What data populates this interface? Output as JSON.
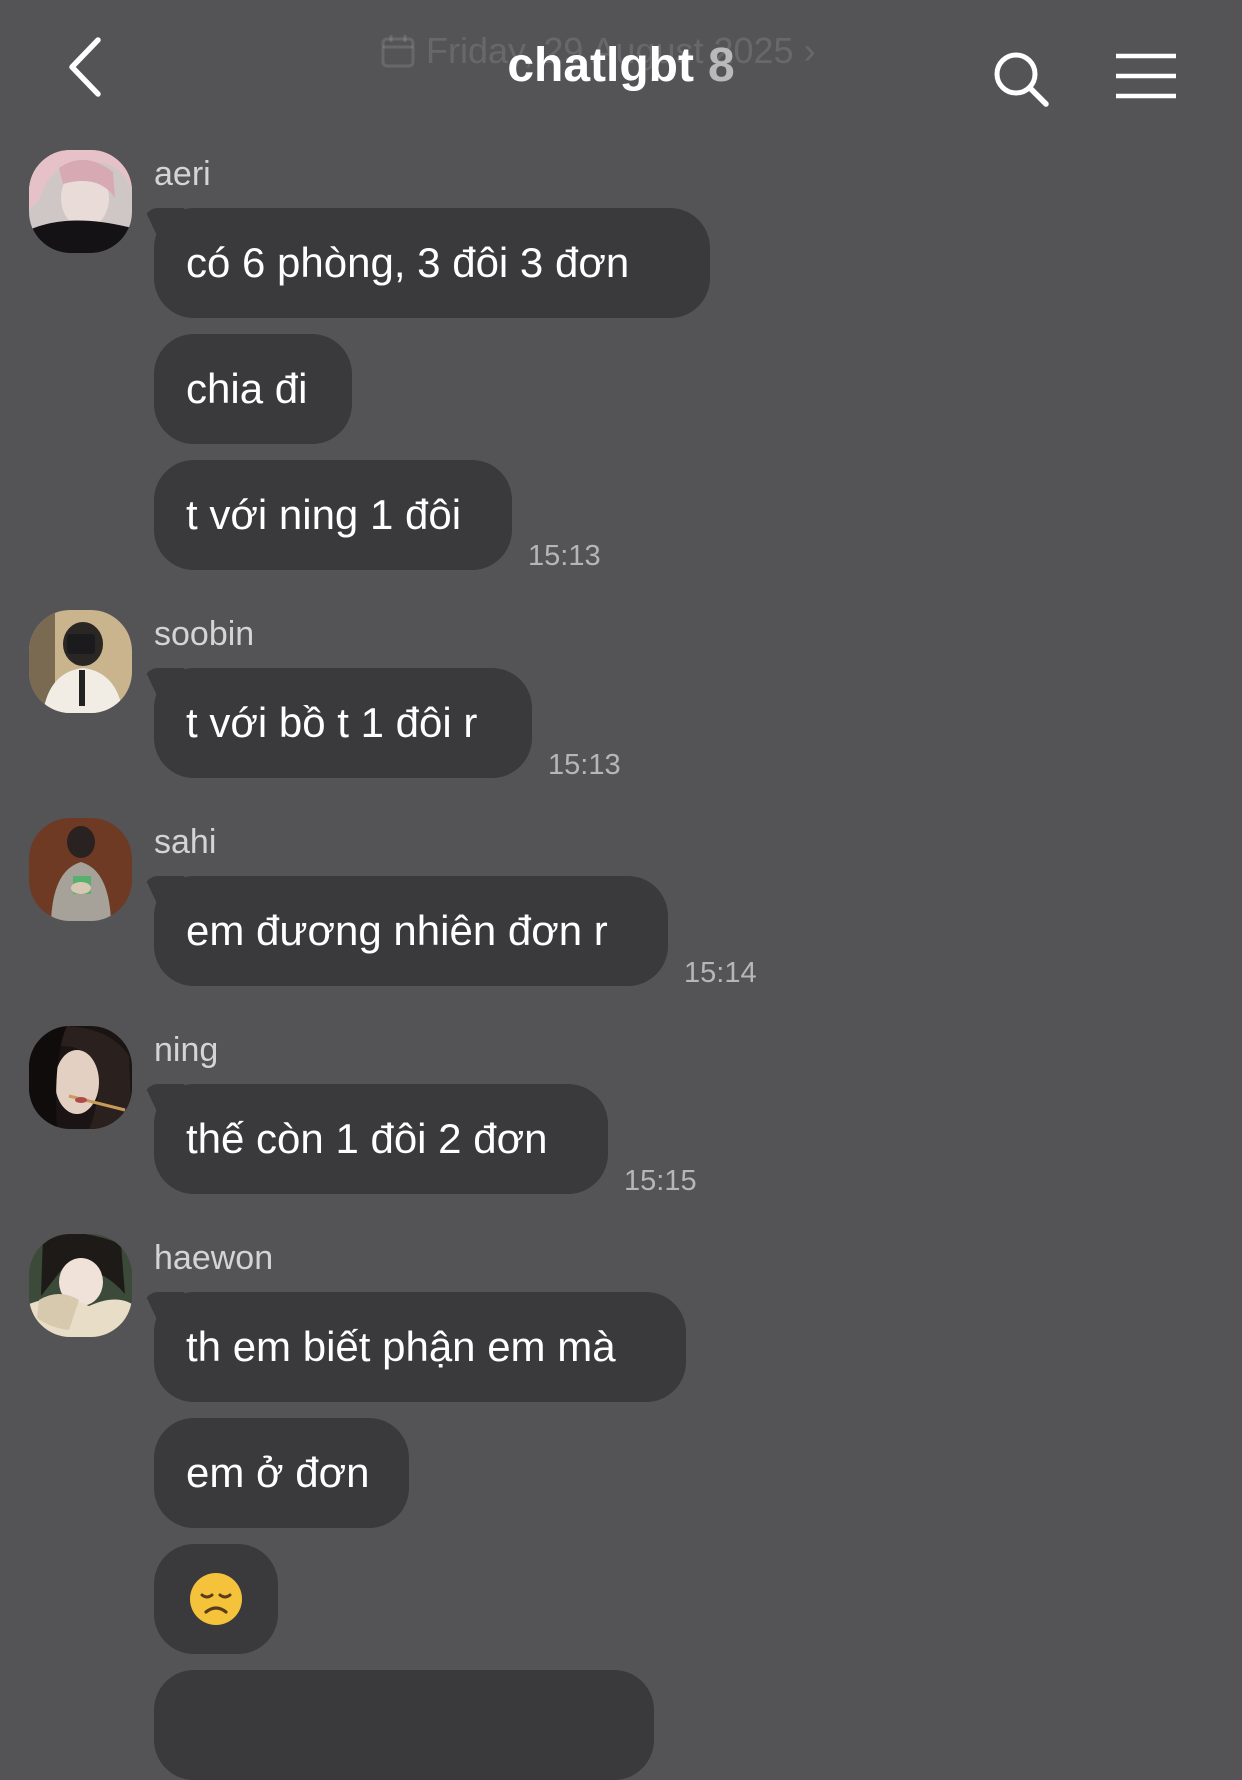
{
  "header": {
    "date_ghost": "Friday, 29 August 2025",
    "title": "chatlgbt",
    "member_count": "8"
  },
  "messages": [
    {
      "sender": "aeri",
      "bubbles": [
        "có 6 phòng, 3 đôi 3 đơn",
        "chia đi",
        "t với ning 1 đôi"
      ],
      "time": "15:13"
    },
    {
      "sender": "soobin",
      "bubbles": [
        "t với bồ t 1 đôi r"
      ],
      "time": "15:13"
    },
    {
      "sender": "sahi",
      "bubbles": [
        "em đương nhiên đơn r"
      ],
      "time": "15:14"
    },
    {
      "sender": "ning",
      "bubbles": [
        "thế còn 1 đôi 2 đơn"
      ],
      "time": "15:15"
    },
    {
      "sender": "haewon",
      "bubbles": [
        "th em biết phận em mà",
        "em ở đơn",
        "😞"
      ],
      "emoji_name": "disappointed-face-emoji"
    }
  ],
  "colors": {
    "background": "#545356",
    "bubble": "#3a393c",
    "timestamp": "#b6b5b8",
    "sender": "#d4d3d6"
  },
  "icons": [
    "chevron-left-icon",
    "calendar-icon",
    "search-icon",
    "hamburger-menu-icon"
  ]
}
